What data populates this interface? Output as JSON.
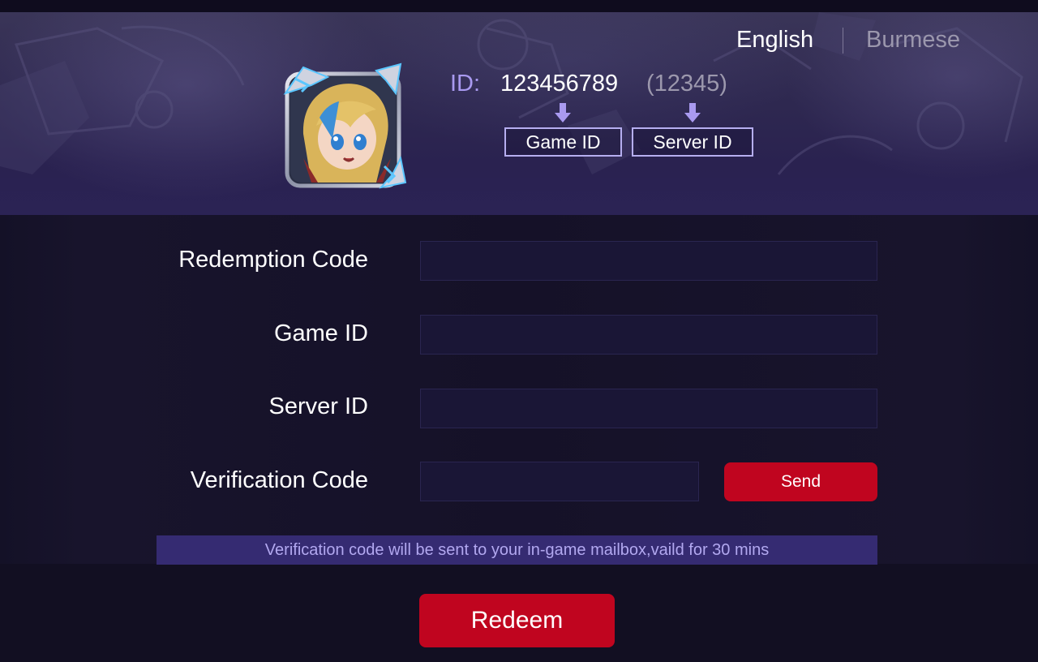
{
  "language": {
    "current": "English",
    "other": "Burmese"
  },
  "id_hint": {
    "label": "ID:",
    "game_id_value": "123456789",
    "server_id_value": "(12345)",
    "game_id_box": "Game ID",
    "server_id_box": "Server ID",
    "arrow_icon": "arrow-down-icon"
  },
  "form": {
    "redemption_code": {
      "label": "Redemption Code",
      "value": "",
      "placeholder": ""
    },
    "game_id": {
      "label": "Game ID",
      "value": "",
      "placeholder": ""
    },
    "server_id": {
      "label": "Server ID",
      "value": "",
      "placeholder": ""
    },
    "verification_code": {
      "label": "Verification Code",
      "value": "",
      "placeholder": ""
    },
    "send_label": "Send",
    "notice": "Verification code will be sent to your in-game mailbox,vaild for 30 mins",
    "redeem_label": "Redeem"
  },
  "colors": {
    "accent_red": "#c0051f",
    "lavender": "#a99af0",
    "notice_bg": "#352b72",
    "page_bg": "#120f22"
  }
}
